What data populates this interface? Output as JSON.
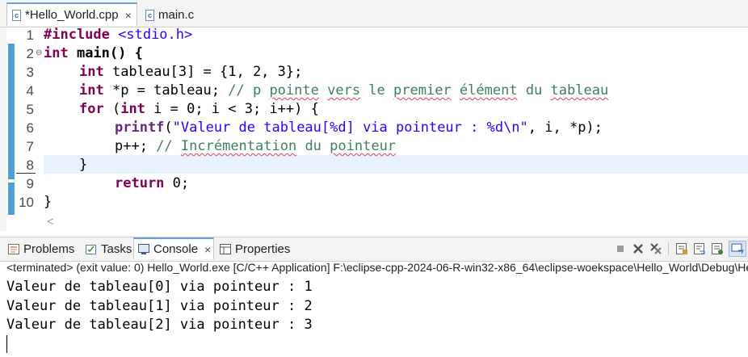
{
  "editor_tabs": [
    {
      "icon": "c-file-icon",
      "label": "*Hello_World.cpp",
      "close": "×"
    },
    {
      "icon": "c-file-icon",
      "label": "main.c"
    }
  ],
  "file_icon_letter": "c",
  "line_numbers": [
    "1",
    "2",
    "3",
    "4",
    "5",
    "6",
    "7",
    "8",
    "9",
    "10"
  ],
  "code": {
    "l1_kw": "#include",
    "l1_inc": " <stdio.h>",
    "l2_kw": "int",
    "l2_rest": " main() {",
    "l3_kw": "int",
    "l3_rest": " tableau[3] = {1, 2, 3};",
    "l4_kw": "int",
    "l4_rest": " *p = tableau; ",
    "l4_c1": "// p ",
    "l4_c2": "pointe",
    "l4_c3": " ",
    "l4_c4": "vers",
    "l4_c5": " le ",
    "l4_c6": "premier",
    "l4_c7": " ",
    "l4_c8": "élément",
    "l4_c9": " du ",
    "l4_c10": "tableau",
    "l5_kw": "for",
    "l5_a": " (",
    "l5_kw2": "int",
    "l5_rest": " i = 0; i < 3; i++) {",
    "l6_fn": "printf",
    "l6_a": "(",
    "l6_str": "\"Valeur de tableau[%d] via pointeur : %d\\n\"",
    "l6_rest": ", i, *p);",
    "l7_a": "p++; ",
    "l7_c1": "// ",
    "l7_c2": "Incrémentation",
    "l7_c3": " du ",
    "l7_c4": "pointeur",
    "l8": "}",
    "l9_kw": "return",
    "l9_rest": " 0;",
    "l10": "}"
  },
  "scroll_arrow": "<",
  "panel_tabs": [
    {
      "icon": "problems-icon",
      "label": "Problems"
    },
    {
      "icon": "tasks-icon",
      "label": "Tasks"
    },
    {
      "icon": "console-icon",
      "label": "Console",
      "close": "×"
    },
    {
      "icon": "properties-icon",
      "label": "Properties"
    }
  ],
  "console_status": "<terminated> (exit value: 0) Hello_World.exe [C/C++ Application] F:\\eclipse-cpp-2024-06-R-win32-x86_64\\eclipse-woekspace\\Hello_World\\Debug\\Hello_World.exe",
  "console_output": [
    "Valeur de tableau[0] via pointeur : 1",
    "Valeur de tableau[1] via pointeur : 2",
    "Valeur de tableau[2] via pointeur : 3"
  ],
  "colors": {
    "keyword": "#7f0055",
    "comment": "#3f7f5f",
    "string": "#2a00ff",
    "change_bar": "#4f9fd4",
    "current_line": "#e8f2fe"
  }
}
